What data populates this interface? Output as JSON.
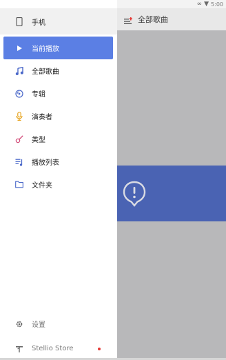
{
  "status_bar": {
    "time": "5:00"
  },
  "top_bar": {
    "title": "全部歌曲",
    "menu_icon": "playlist-menu-icon"
  },
  "drawer": {
    "header_item": {
      "label": "手机",
      "icon": "phone-icon"
    },
    "items": [
      {
        "label": "当前播放",
        "icon": "play-icon",
        "active": true
      },
      {
        "label": "全部歌曲",
        "icon": "music-note-icon"
      },
      {
        "label": "专辑",
        "icon": "album-icon"
      },
      {
        "label": "演奏者",
        "icon": "microphone-icon"
      },
      {
        "label": "类型",
        "icon": "guitar-icon"
      },
      {
        "label": "播放列表",
        "icon": "playlist-icon"
      },
      {
        "label": "文件夹",
        "icon": "folder-icon"
      }
    ],
    "footer_items": [
      {
        "label": "设置",
        "icon": "gear-icon"
      },
      {
        "label": "Stellio Store",
        "icon": "antenna-icon",
        "badge": "notification-dot"
      }
    ]
  },
  "colors": {
    "accent": "#5b7fe4",
    "overlay_card": "#4a63b3",
    "badge": "#e53935"
  }
}
